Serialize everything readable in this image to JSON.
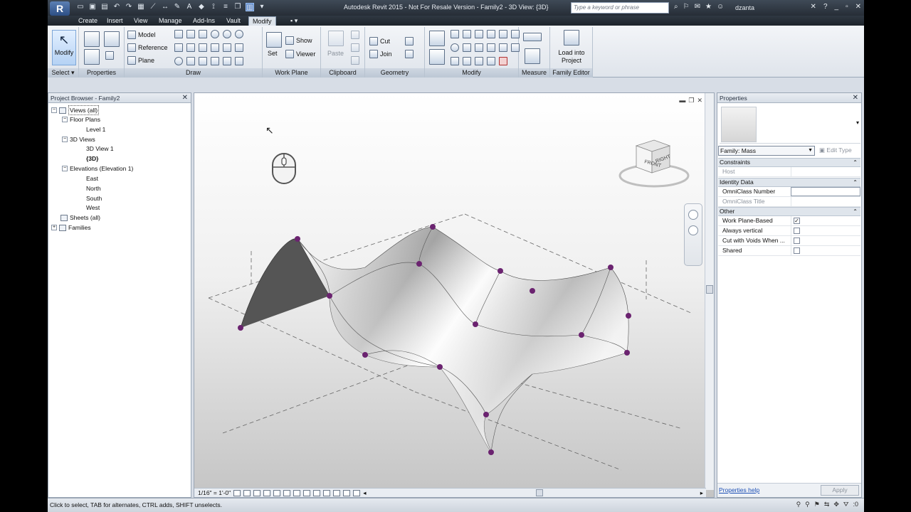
{
  "app": {
    "title": "Autodesk Revit 2015 -  Not For Resale Version -    Family2 - 3D View: {3D}",
    "logo_letter": "R",
    "search_placeholder": "Type a keyword or phrase",
    "user": "dzanta"
  },
  "tabs": [
    {
      "label": "Create"
    },
    {
      "label": "Insert"
    },
    {
      "label": "View"
    },
    {
      "label": "Manage"
    },
    {
      "label": "Add-Ins"
    },
    {
      "label": "Vault"
    },
    {
      "label": "Modify"
    },
    {
      "label": "▪ ▾"
    }
  ],
  "ribbon": {
    "modify_label": "Modify",
    "panels": {
      "select": "Select ▾",
      "properties": "Properties",
      "draw": "Draw",
      "work_plane": "Work Plane",
      "clipboard": "Clipboard",
      "geometry": "Geometry",
      "modify": "Modify",
      "measure": "Measure",
      "family_editor": "Family Editor"
    },
    "draw": {
      "model": "Model",
      "reference": "Reference",
      "plane": "Plane"
    },
    "work_plane": {
      "set": "Set",
      "show": "Show",
      "viewer": "Viewer"
    },
    "clipboard": {
      "paste": "Paste"
    },
    "geometry": {
      "cut": "Cut",
      "join": "Join"
    },
    "family_editor": {
      "load_into_project": "Load into Project"
    }
  },
  "project_browser": {
    "title": "Project Browser - Family2",
    "items": [
      {
        "label": "Views (all)",
        "toggle": "−"
      },
      {
        "label": "Floor Plans",
        "toggle": "−"
      },
      {
        "label": "Level 1",
        "toggle": ""
      },
      {
        "label": "3D Views",
        "toggle": "−"
      },
      {
        "label": "3D View 1",
        "toggle": ""
      },
      {
        "label": "{3D}",
        "toggle": ""
      },
      {
        "label": "Elevations (Elevation 1)",
        "toggle": "−"
      },
      {
        "label": "East",
        "toggle": ""
      },
      {
        "label": "North",
        "toggle": ""
      },
      {
        "label": "South",
        "toggle": ""
      },
      {
        "label": "West",
        "toggle": ""
      },
      {
        "label": "Sheets (all)",
        "toggle": ""
      },
      {
        "label": "Families",
        "toggle": "+"
      }
    ]
  },
  "viewport": {
    "scale": "1/16\" = 1'-0\"",
    "viewcube": {
      "front": "FRONT",
      "right": "RIGHT"
    },
    "colors": {
      "control_point": "#6b2370",
      "surface": "#ffffff"
    }
  },
  "properties": {
    "title": "Properties",
    "type_selector": "Family: Mass",
    "edit_type": "Edit Type",
    "sections": {
      "constraints": "Constraints",
      "identity": "Identity Data",
      "other": "Other"
    },
    "rows": {
      "host": "Host",
      "omniclass_number": "OmniClass Number",
      "omniclass_title": "OmniClass Title",
      "work_plane_based": "Work Plane-Based",
      "always_vertical": "Always vertical",
      "cut_with_voids": "Cut with Voids When ...",
      "shared": "Shared"
    },
    "checks": {
      "work_plane_based": "✓",
      "always_vertical": "",
      "cut_with_voids": "",
      "shared": ""
    },
    "help": "Properties help",
    "apply": "Apply"
  },
  "status": {
    "text": "Click to select, TAB for alternates, CTRL adds, SHIFT unselects.",
    "filter_count": ":0"
  }
}
